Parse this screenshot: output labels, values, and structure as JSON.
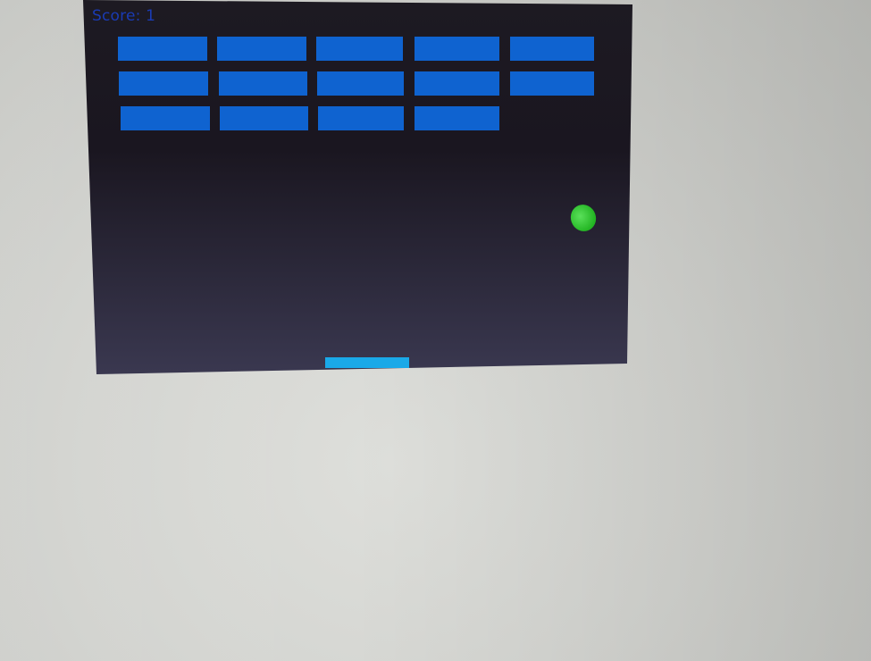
{
  "game": {
    "score_text": "Score: 1",
    "score": 1
  },
  "colors": {
    "page_background": "#d6d7d3",
    "canvas_background": "#201d2a",
    "canvas_background_bottom": "#3a3850",
    "brick": "#0f63d0",
    "paddle": "#1aa9e8",
    "ball": "#2fd12f",
    "score_text": "#1a3fc4"
  },
  "bricks": [
    [
      true,
      true,
      true,
      true,
      true
    ],
    [
      true,
      true,
      true,
      true,
      true
    ],
    [
      true,
      true,
      true,
      true,
      false
    ]
  ],
  "icons": {
    "ball": "green-ball-icon",
    "paddle": "paddle-icon"
  }
}
